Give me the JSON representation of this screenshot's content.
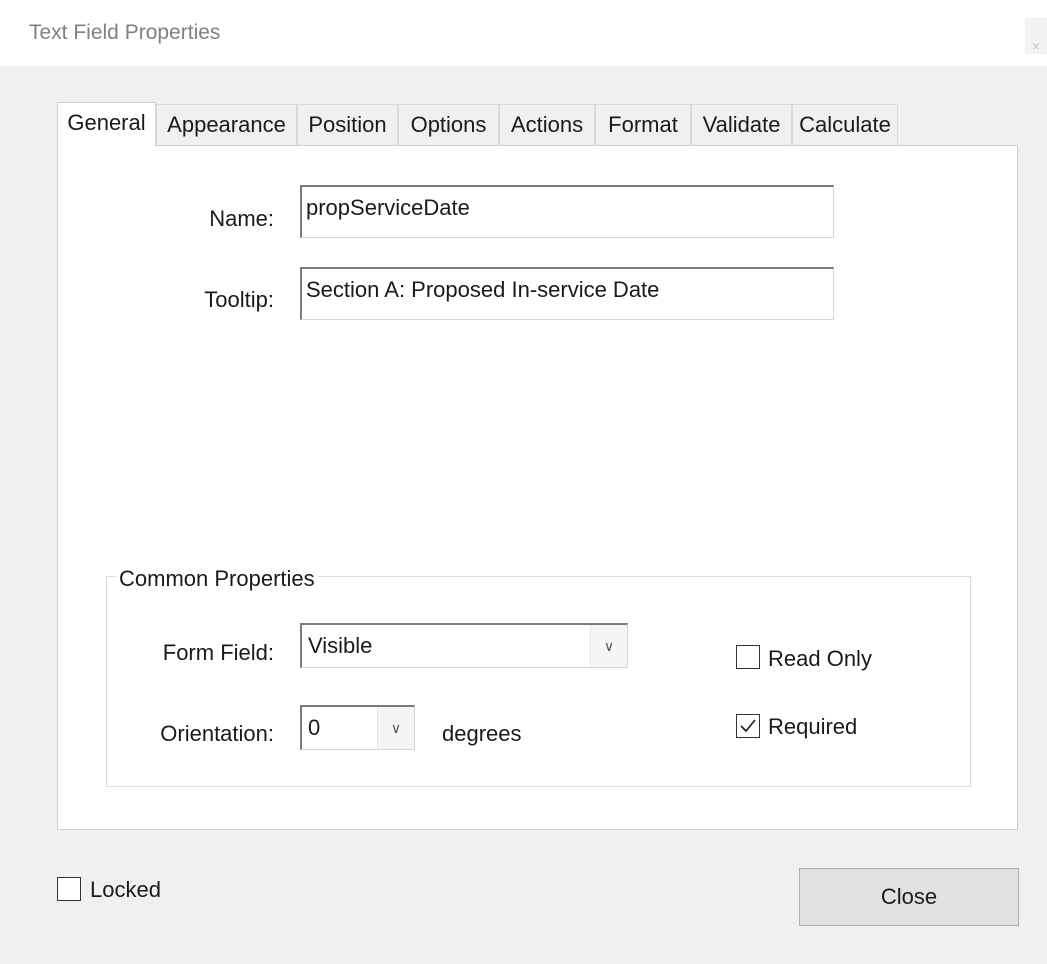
{
  "window": {
    "title": "Text Field Properties",
    "close_glyph": "×"
  },
  "tabs": [
    {
      "label": "General",
      "active": true
    },
    {
      "label": "Appearance"
    },
    {
      "label": "Position"
    },
    {
      "label": "Options"
    },
    {
      "label": "Actions"
    },
    {
      "label": "Format"
    },
    {
      "label": "Validate"
    },
    {
      "label": "Calculate"
    }
  ],
  "general": {
    "name_label": "Name:",
    "name_value": "propServiceDate",
    "tooltip_label": "Tooltip:",
    "tooltip_value": "Section A: Proposed In-service Date"
  },
  "common": {
    "legend": "Common Properties",
    "form_field_label": "Form Field:",
    "form_field_value": "Visible",
    "orientation_label": "Orientation:",
    "orientation_value": "0",
    "degrees_label": "degrees",
    "read_only_label": "Read Only",
    "read_only_checked": false,
    "required_label": "Required",
    "required_checked": true
  },
  "footer": {
    "locked_label": "Locked",
    "locked_checked": false,
    "close_label": "Close"
  },
  "colors": {
    "window_bg": "#f0f0f0",
    "panel_bg": "#ffffff",
    "title_text": "#808080",
    "button_bg": "#e1e1e1"
  }
}
